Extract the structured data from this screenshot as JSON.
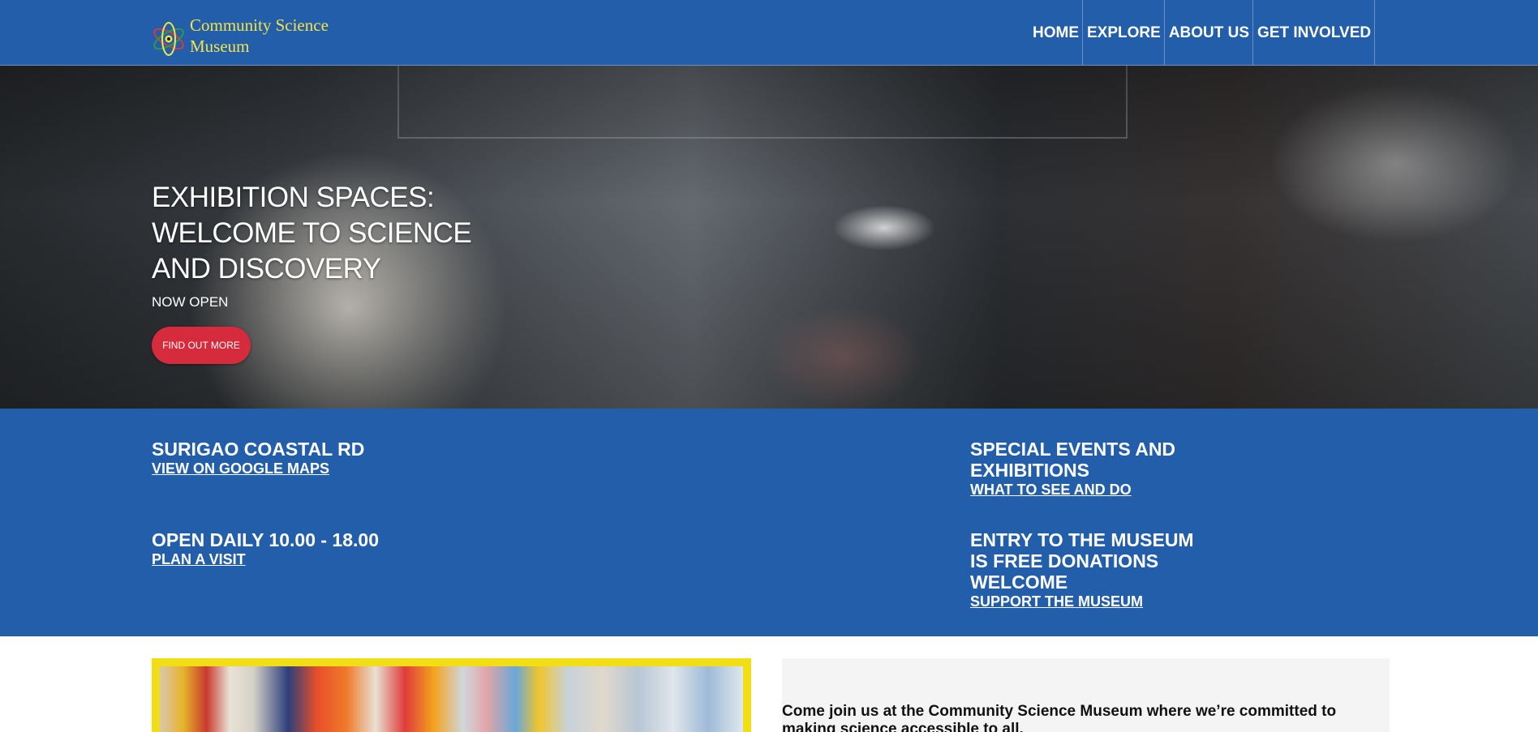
{
  "header": {
    "logo_line1": "Community Science",
    "logo_line2": "Museum",
    "nav": [
      "HOME",
      "EXPLORE",
      "ABOUT US",
      "GET INVOLVED"
    ]
  },
  "hero": {
    "title": "EXHIBITION SPACES: WELCOME TO SCIENCE AND DISCOVERY",
    "subtitle": "NOW OPEN",
    "button_label": "FIND OUT MORE"
  },
  "info": {
    "location": {
      "heading": "SURIGAO COASTAL RD",
      "link": "VIEW ON GOOGLE MAPS"
    },
    "hours": {
      "heading": "OPEN DAILY 10.00 - 18.00",
      "link": "PLAN A VISIT"
    },
    "events": {
      "heading": "SPECIAL EVENTS AND EXHIBITIONS",
      "link": "WHAT TO SEE AND DO"
    },
    "entry": {
      "heading": "ENTRY TO THE MUSEUM IS FREE DONATIONS WELCOME",
      "link": "SUPPORT THE MUSEUM"
    }
  },
  "intro": {
    "text": "Come join us at the Community Science Museum where we’re committed to making science accessible to all."
  },
  "colors": {
    "brand_blue": "#235eab",
    "logo_yellow": "#f2e34c",
    "button_red": "#d62b3d",
    "frame_yellow": "#f2de14"
  }
}
